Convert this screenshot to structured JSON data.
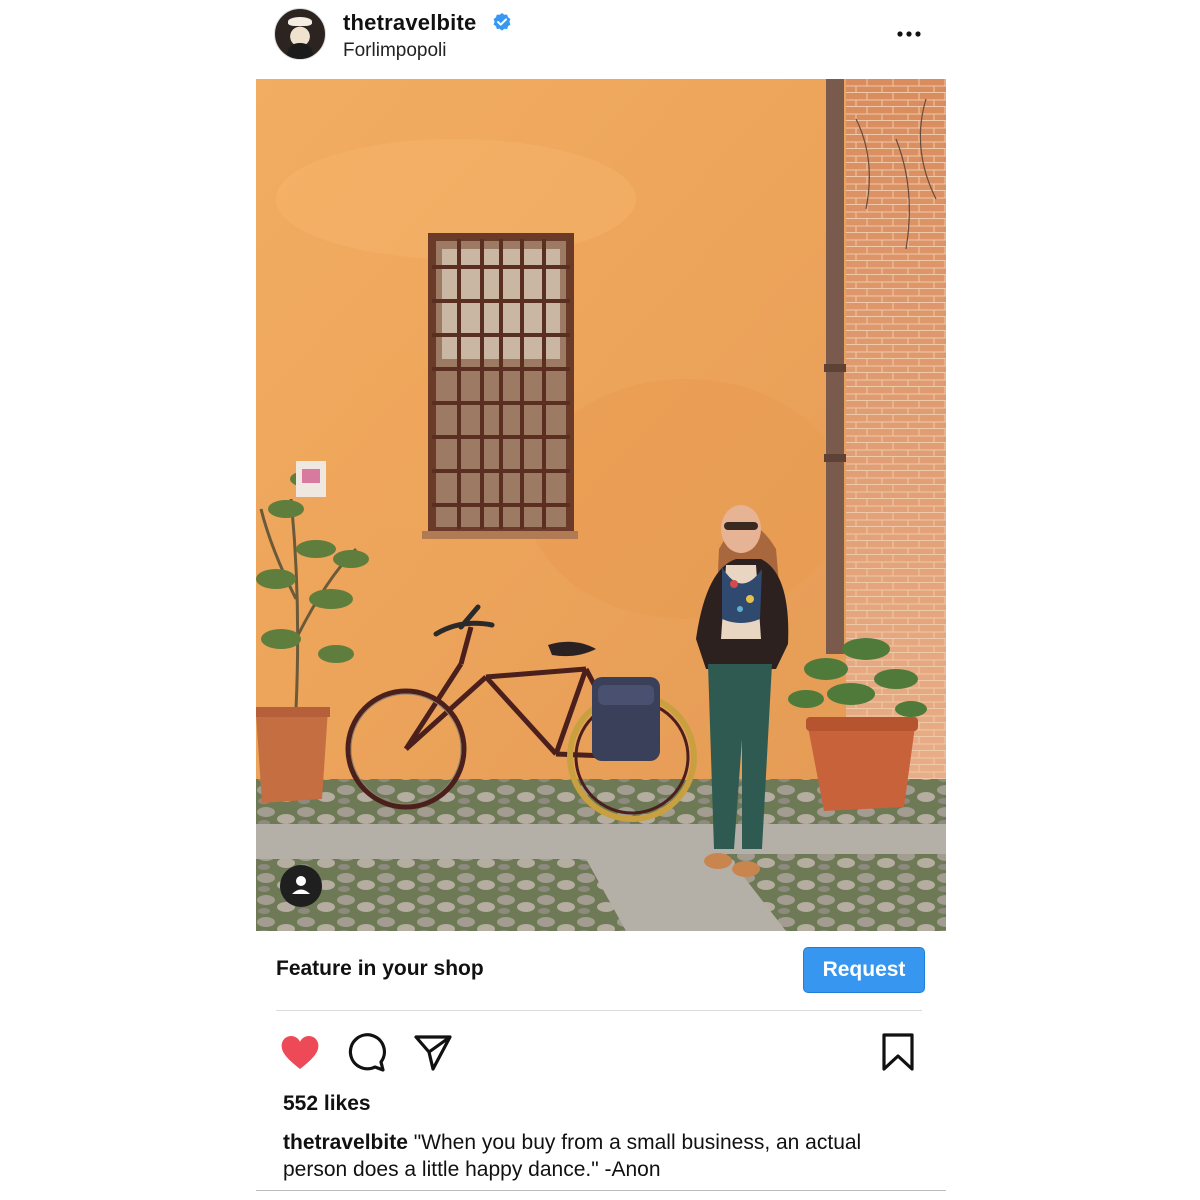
{
  "post": {
    "username": "thetravelbite",
    "location": "Forlimpopoli",
    "verified": true
  },
  "icons": {
    "more": "more-options-icon",
    "verified": "verified-badge-icon",
    "tag": "tagged-user-icon",
    "like": "heart-icon",
    "comment": "comment-icon",
    "share": "share-icon",
    "save": "bookmark-icon"
  },
  "shop": {
    "label": "Feature in your shop",
    "button_label": "Request"
  },
  "likes": "552 likes",
  "caption": {
    "user": "thetravelbite",
    "text": "\"When you buy from a small business, an actual person does a little happy dance.\" -Anon"
  },
  "colors": {
    "accent": "#3797f0",
    "like_red": "#ed4956",
    "wall": "#eda65c"
  }
}
